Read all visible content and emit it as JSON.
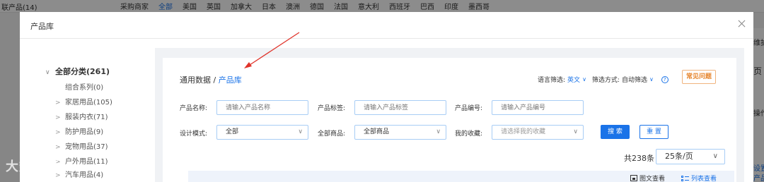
{
  "background": {
    "page_title": "联产品(14)",
    "menu": [
      "采购商家",
      "全部",
      "美国",
      "英国",
      "加拿大",
      "日本",
      "澳洲",
      "德国",
      "法国",
      "意大利",
      "西班牙",
      "巴西",
      "印度",
      "墨西哥"
    ],
    "right_items": [
      "维护",
      "页",
      "操作",
      "设置",
      "产品"
    ]
  },
  "modal": {
    "title": "产品库"
  },
  "tree": {
    "root": "全部分类(261)",
    "items": [
      {
        "label": "组合系列(0)",
        "has_children": false
      },
      {
        "label": "家居用品(105)",
        "has_children": true
      },
      {
        "label": "服装内衣(71)",
        "has_children": true
      },
      {
        "label": "防护用品(9)",
        "has_children": true
      },
      {
        "label": "宠物用品(37)",
        "has_children": true
      },
      {
        "label": "户外用品(11)",
        "has_children": true
      },
      {
        "label": "汽车用品(4)",
        "has_children": true
      }
    ]
  },
  "breadcrumb": {
    "parent": "通用数据",
    "separator": " / ",
    "current": "产品库"
  },
  "filters": {
    "lang_label": "语言筛选:",
    "lang_value": "英文",
    "mode_label": "筛选方式:",
    "mode_value": "自动筛选",
    "help": "?"
  },
  "faq_button": "常见问题",
  "form": {
    "product_name_label": "产品名称:",
    "product_name_placeholder": "请输入产品名称",
    "product_tag_label": "产品标签:",
    "product_tag_placeholder": "请输入产品标签",
    "product_code_label": "产品编号:",
    "product_code_placeholder": "请输入产品编号",
    "design_mode_label": "设计模式:",
    "design_mode_value": "全部",
    "all_products_label": "全部商品:",
    "all_products_value": "全部商品",
    "favorites_label": "我的收藏:",
    "favorites_placeholder": "请选择我的收藏",
    "search_button": "搜 索",
    "reset_button": "重 置"
  },
  "pagination": {
    "total": "共238条",
    "page_size": "25条/页"
  },
  "view": {
    "grid_label": "图文查看",
    "list_label": "列表查看"
  },
  "watermark": "大数跨境",
  "colors": {
    "accent": "#1a73e8",
    "faq": "#e6862f",
    "arrow": "#e0332a"
  }
}
